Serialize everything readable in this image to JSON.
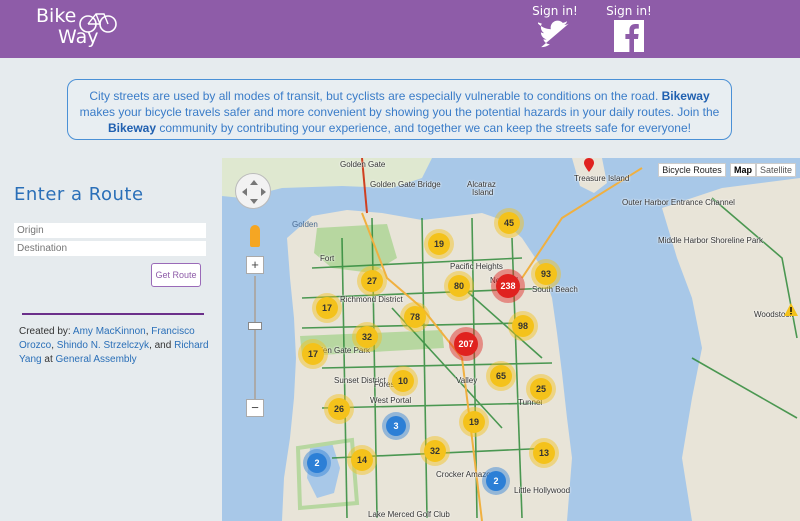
{
  "header": {
    "logo_line1": "Bike",
    "logo_line2": "Way",
    "signin_twitter": "Sign in!",
    "signin_facebook": "Sign in!",
    "colors": {
      "header_bg": "#8e5ca8",
      "accent": "#2a6fb8"
    }
  },
  "intro": {
    "text_part1": "City streets are used by all modes of transit, but cyclists are especially vulnerable to conditions on the road. ",
    "brand1": "Bikeway",
    "text_part2": " makes your bicycle travels safer and more convenient by showing you the potential hazards in your daily routes. Join the ",
    "brand2": "Bikeway",
    "text_part3": " community by contributing your experience, and together we can keep the streets safe for everyone!"
  },
  "sidebar": {
    "title": "Enter a Route",
    "origin_placeholder": "Origin",
    "destination_placeholder": "Destination",
    "get_route_label": "Get Route",
    "credits_prefix": "Created by: ",
    "author1": "Amy MacKinnon",
    "sep1": ", ",
    "author2": "Francisco Orozco",
    "sep2": ", ",
    "author3": "Shindo N. Strzelczyk",
    "sep3": ", and ",
    "author4": "Richard Yang",
    "at": " at ",
    "org": "General Assembly"
  },
  "map": {
    "bicycle_routes_label": "Bicycle Routes",
    "map_label": "Map",
    "satellite_label": "Satellite",
    "zoom_in": "+",
    "zoom_out": "−",
    "places": {
      "golden_gate_bridge": "Golden Gate Bridge",
      "golden": "Golden",
      "golden_gate": "Golden Gate",
      "alcatraz": "Alcatraz",
      "alcatraz2": "Island",
      "fort": "Fort",
      "pacific_heights": "Pacific Heights",
      "nob_hill": "Nob Hill",
      "south_beach": "South Beach",
      "richmond_district": "Richmond District",
      "golden_gate_park": "Golden Gate Park",
      "sunset_district": "Sunset District",
      "forest": "Forest",
      "west_portal": "West Portal",
      "valley": "Valley",
      "outer_harbor": "Outer Harbor Entrance Channel",
      "treasure_island": "Treasure Island",
      "middle_harbor": "Middle Harbor Shoreline Park",
      "woodstock": "Woodstock",
      "lake_merced": "Lake Merced Golf Club",
      "crocker": "Crocker Amazon",
      "little_hollywood": "Little Hollywood",
      "tunnel": "Tunnel"
    },
    "clusters": [
      {
        "count": "45",
        "kind": "y"
      },
      {
        "count": "19",
        "kind": "y"
      },
      {
        "count": "93",
        "kind": "y"
      },
      {
        "count": "27",
        "kind": "y"
      },
      {
        "count": "80",
        "kind": "y"
      },
      {
        "count": "238",
        "kind": "r"
      },
      {
        "count": "17",
        "kind": "y"
      },
      {
        "count": "78",
        "kind": "y"
      },
      {
        "count": "98",
        "kind": "y"
      },
      {
        "count": "32",
        "kind": "y"
      },
      {
        "count": "207",
        "kind": "r"
      },
      {
        "count": "17",
        "kind": "y"
      },
      {
        "count": "10",
        "kind": "y"
      },
      {
        "count": "65",
        "kind": "y"
      },
      {
        "count": "25",
        "kind": "y"
      },
      {
        "count": "26",
        "kind": "y"
      },
      {
        "count": "3",
        "kind": "b"
      },
      {
        "count": "19",
        "kind": "y"
      },
      {
        "count": "2",
        "kind": "b"
      },
      {
        "count": "14",
        "kind": "y"
      },
      {
        "count": "32",
        "kind": "y"
      },
      {
        "count": "13",
        "kind": "y"
      },
      {
        "count": "2",
        "kind": "b"
      }
    ]
  }
}
